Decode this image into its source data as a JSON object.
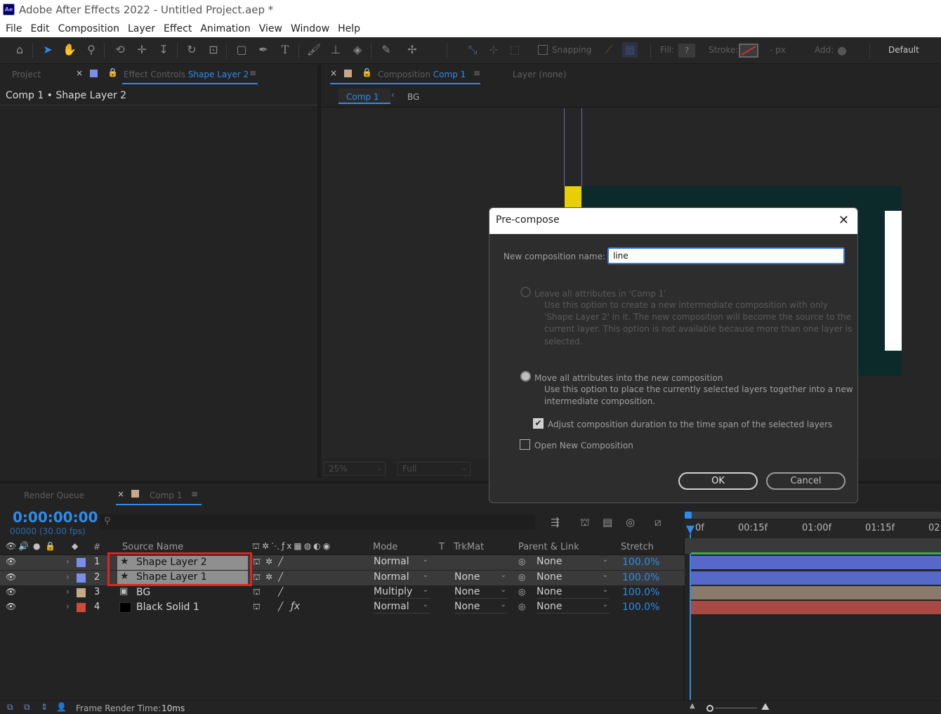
{
  "app": {
    "title": "Adobe After Effects 2022 - Untitled Project.aep *",
    "logo": "Ae"
  },
  "menu": [
    "File",
    "Edit",
    "Composition",
    "Layer",
    "Effect",
    "Animation",
    "View",
    "Window",
    "Help"
  ],
  "toolbar": {
    "snapping": "Snapping",
    "fill": "Fill:",
    "stroke": "Stroke:",
    "px": "- px",
    "add": "Add:",
    "workspace": "Default",
    "fill_q": "?"
  },
  "left_panel": {
    "tab_project": "Project",
    "tab_effect_prefix": "Effect Controls",
    "tab_effect_layer": "Shape Layer 2",
    "breadcrumb": "Comp 1 • Shape Layer 2"
  },
  "viewer": {
    "tab_prefix": "Composition",
    "tab_comp": "Comp 1",
    "layer_tab": "Layer (none)",
    "crumb_active": "Comp 1",
    "crumb_other": "BG",
    "zoom": "25%",
    "resolution": "Full"
  },
  "dialog": {
    "title": "Pre-compose",
    "name_label": "New composition name:",
    "name_value": "line",
    "opt1_title": "Leave all attributes in 'Comp 1'",
    "opt1_desc": [
      "Use this option to create a new intermediate composition with only",
      "'Shape Layer 2' in it. The new composition will become the source to the",
      "current layer. This option is not available because more than one layer is",
      "selected."
    ],
    "opt2_title": "Move all attributes into the new composition",
    "opt2_desc": [
      "Use this option to place the currently selected layers together into a new",
      "intermediate composition."
    ],
    "adjust_label": "Adjust composition duration to the time span of the selected layers",
    "open_label": "Open New Composition",
    "ok": "OK",
    "cancel": "Cancel"
  },
  "timeline": {
    "tab_render": "Render Queue",
    "tab_comp": "Comp 1",
    "timecode": "0:00:00:00",
    "fps": "00000 (30.00 fps)",
    "headers": {
      "num": "#",
      "source": "Source Name",
      "mode": "Mode",
      "t": "T",
      "trkmat": "TrkMat",
      "parent": "Parent & Link",
      "stretch": "Stretch"
    },
    "ruler": [
      "0f",
      "00:15f",
      "01:00f",
      "01:15f",
      "02"
    ],
    "layers": [
      {
        "num": "1",
        "name": "Shape Layer 2",
        "mode": "Normal",
        "trkmat": "",
        "parent": "None",
        "stretch": "100.0%",
        "label_color": "#7b8fe8",
        "bar_color": "#5668c8",
        "selected": true
      },
      {
        "num": "2",
        "name": "Shape Layer 1",
        "mode": "Normal",
        "trkmat": "None",
        "parent": "None",
        "stretch": "100.0%",
        "label_color": "#7b8fe8",
        "bar_color": "#5668c8",
        "selected": true
      },
      {
        "num": "3",
        "name": "BG",
        "mode": "Multiply",
        "trkmat": "None",
        "parent": "None",
        "stretch": "100.0%",
        "label_color": "#c8a888",
        "bar_color": "#8a7a6a",
        "selected": false
      },
      {
        "num": "4",
        "name": "Black Solid 1",
        "mode": "Normal",
        "trkmat": "None",
        "parent": "None",
        "stretch": "100.0%",
        "label_color": "#d04a3a",
        "bar_color": "#a84a44",
        "selected": false
      }
    ]
  },
  "status": {
    "frame_label": "Frame Render Time:",
    "frame_value": "10ms"
  },
  "colors": {
    "accent": "#2d8ceb",
    "highlight": "#e02424",
    "comp_bg": "#0d2a2a",
    "yellow": "#e8d000"
  }
}
